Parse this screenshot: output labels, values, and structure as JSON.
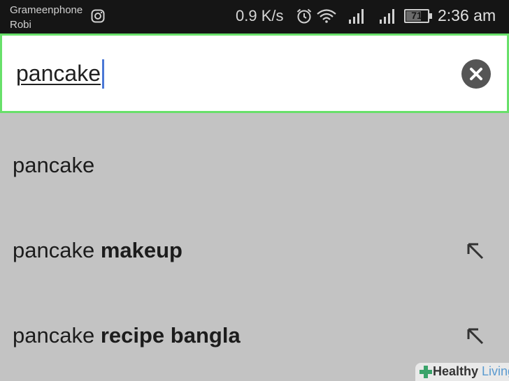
{
  "status_bar": {
    "carrier_line1": "Grameenphone",
    "carrier_line2": "Robi",
    "speed": "0.9 K/s",
    "battery_level": "71",
    "battery_fraction": 0.71,
    "time": "2:36 am",
    "icons": [
      "instagram-icon",
      "alarm-icon",
      "wifi-icon",
      "signal-icon",
      "signal-icon",
      "battery-icon"
    ]
  },
  "search": {
    "value": "pancake",
    "clear_icon": "close-icon",
    "border_color": "#68e06a",
    "caret_color": "#4b78d6"
  },
  "suggestions": [
    {
      "prefix": "pancake",
      "suffix": "",
      "has_fill_arrow": false
    },
    {
      "prefix": "pancake ",
      "suffix": "makeup",
      "has_fill_arrow": true
    },
    {
      "prefix": "pancake ",
      "suffix": "recipe bangla",
      "has_fill_arrow": true
    }
  ],
  "watermark": {
    "part1": "Healthy",
    "part2": " Living"
  }
}
